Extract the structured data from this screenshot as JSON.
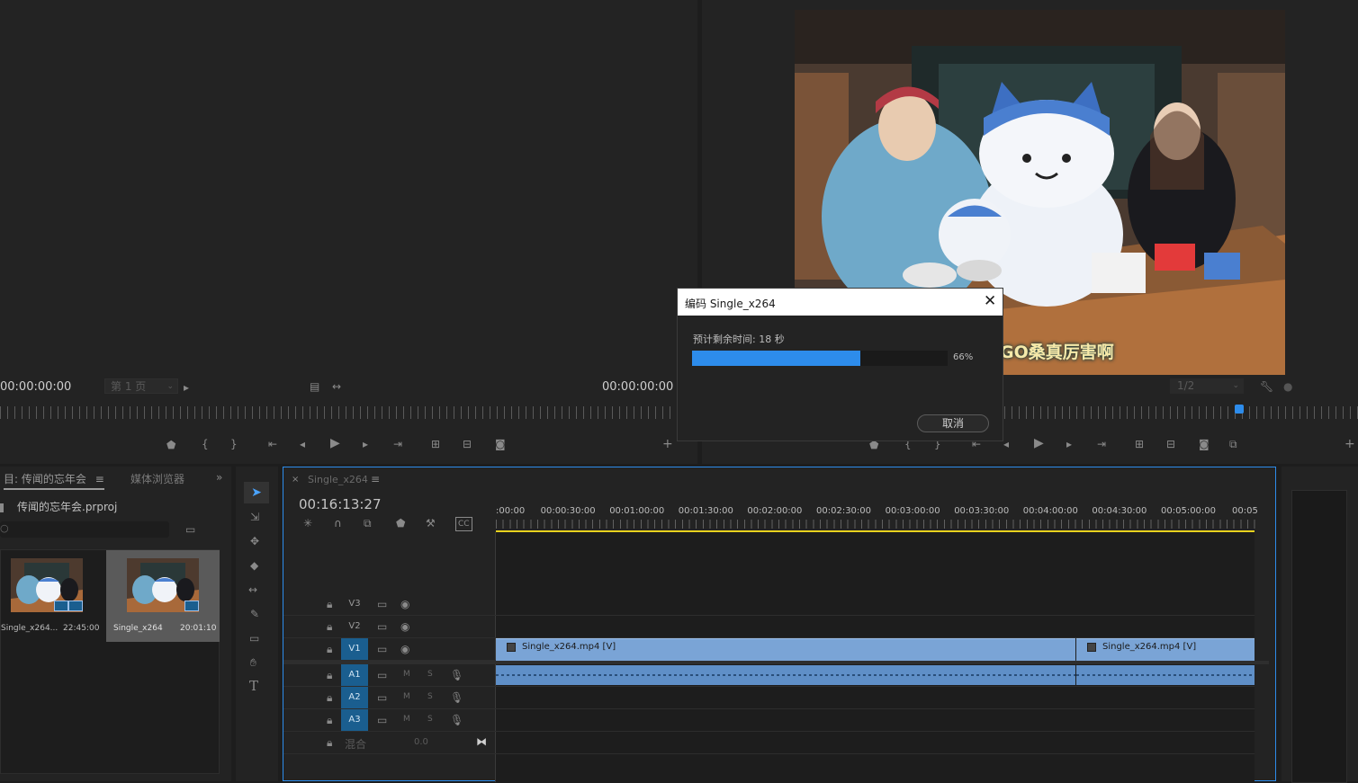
{
  "source_monitor": {
    "timecode_in": "00:00:00:00",
    "timecode_out": "00:00:00:00",
    "page_select": "第 1 页"
  },
  "program_monitor": {
    "zoom_select": "1/2",
    "video_caption": "GO桑真厉害啊"
  },
  "dialog": {
    "title": "编码 Single_x264",
    "remaining_label": "预计剩余时间: 18 秒",
    "progress": 0.66,
    "progress_text": "66%",
    "cancel_label": "取消"
  },
  "project_panel": {
    "tab_project": "目: 传闻的忘年会",
    "tab_media": "媒体浏览器",
    "project_file": "传闻的忘年会.prproj",
    "items": [
      {
        "name": "Single_x264...",
        "duration": "22:45:00"
      },
      {
        "name": "Single_x264",
        "duration": "20:01:10"
      }
    ]
  },
  "timeline": {
    "tab_label": "Single_x264",
    "timecode": "00:16:13:27",
    "ruler_labels": [
      ":00:00",
      "00:00:30:00",
      "00:01:00:00",
      "00:01:30:00",
      "00:02:00:00",
      "00:02:30:00",
      "00:03:00:00",
      "00:03:30:00",
      "00:04:00:00",
      "00:04:30:00",
      "00:05:00:00",
      "00:05"
    ],
    "video_tracks": [
      "V3",
      "V2",
      "V1"
    ],
    "audio_tracks": [
      "A1",
      "A2",
      "A3"
    ],
    "audio_mute": "M",
    "audio_solo": "S",
    "mix_label": "混合",
    "mix_value": "0.0",
    "clip1_label": "Single_x264.mp4 [V]",
    "clip2_label": "Single_x264.mp4 [V]"
  },
  "colors": {
    "accent": "#2d8ceb",
    "selected_track": "#1a5e8f",
    "video_clip": "#7aa4d6",
    "audio_clip": "#5f8fc7",
    "playhead_bar": "#e8d21e"
  }
}
